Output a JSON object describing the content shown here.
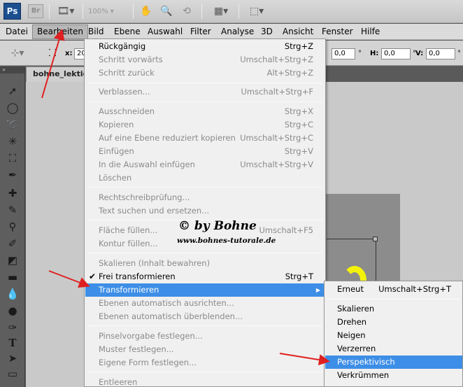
{
  "appbar": {
    "logo": "Ps",
    "bridge": "Br",
    "zoom": "100%"
  },
  "menubar": {
    "items": [
      "Datei",
      "Bearbeiten",
      "Bild",
      "Ebene",
      "Auswahl",
      "Filter",
      "Analyse",
      "3D",
      "Ansicht",
      "Fenster",
      "Hilfe"
    ],
    "active_index": 1
  },
  "options": {
    "x_label": "x:",
    "x_value": "20",
    "angle_value": "0,0",
    "degree": "°",
    "h_label": "H:",
    "h_value": "0,0",
    "v_label": "V:",
    "v_value": "0,0"
  },
  "document": {
    "tab": "bohne_lektion"
  },
  "tools_grip": "»",
  "menu": {
    "items": [
      {
        "label": "Rückgängig",
        "shortcut": "Strg+Z",
        "enabled": true
      },
      {
        "label": "Schritt vorwärts",
        "shortcut": "Umschalt+Strg+Z",
        "enabled": false
      },
      {
        "label": "Schritt zurück",
        "shortcut": "Alt+Strg+Z",
        "enabled": false
      },
      {
        "label": "Verblassen...",
        "shortcut": "Umschalt+Strg+F",
        "enabled": false
      },
      {
        "label": "Ausschneiden",
        "shortcut": "Strg+X",
        "enabled": false
      },
      {
        "label": "Kopieren",
        "shortcut": "Strg+C",
        "enabled": false
      },
      {
        "label": "Auf eine Ebene reduziert kopieren",
        "shortcut": "Umschalt+Strg+C",
        "enabled": false
      },
      {
        "label": "Einfügen",
        "shortcut": "Strg+V",
        "enabled": false
      },
      {
        "label": "In die Auswahl einfügen",
        "shortcut": "Umschalt+Strg+V",
        "enabled": false
      },
      {
        "label": "Löschen",
        "shortcut": "",
        "enabled": false
      },
      {
        "label": "Rechtschreibprüfung...",
        "shortcut": "",
        "enabled": false
      },
      {
        "label": "Text suchen und ersetzen...",
        "shortcut": "",
        "enabled": false
      },
      {
        "label": "Fläche füllen...",
        "shortcut": "Umschalt+F5",
        "enabled": false
      },
      {
        "label": "Kontur füllen...",
        "shortcut": "",
        "enabled": false
      },
      {
        "label": "Skalieren (Inhalt bewahren)",
        "shortcut": "",
        "enabled": false
      },
      {
        "label": "Frei transformieren",
        "shortcut": "Strg+T",
        "enabled": true,
        "checked": true
      },
      {
        "label": "Transformieren",
        "shortcut": "",
        "enabled": true,
        "highlight": true,
        "submenu": true
      },
      {
        "label": "Ebenen automatisch ausrichten...",
        "shortcut": "",
        "enabled": false
      },
      {
        "label": "Ebenen automatisch überblenden...",
        "shortcut": "",
        "enabled": false
      },
      {
        "label": "Pinselvorgabe festlegen...",
        "shortcut": "",
        "enabled": false
      },
      {
        "label": "Muster festlegen...",
        "shortcut": "",
        "enabled": false
      },
      {
        "label": "Eigene Form festlegen...",
        "shortcut": "",
        "enabled": false
      },
      {
        "label": "Entleeren",
        "shortcut": "",
        "enabled": false
      }
    ]
  },
  "submenu": {
    "items": [
      {
        "label": "Erneut",
        "shortcut": "Umschalt+Strg+T"
      },
      {
        "label": "Skalieren",
        "shortcut": ""
      },
      {
        "label": "Drehen",
        "shortcut": ""
      },
      {
        "label": "Neigen",
        "shortcut": ""
      },
      {
        "label": "Verzerren",
        "shortcut": ""
      },
      {
        "label": "Perspektivisch",
        "shortcut": "",
        "highlight": true
      },
      {
        "label": "Verkrümmen",
        "shortcut": ""
      }
    ]
  },
  "watermark": {
    "line1": "© by Bohne",
    "line2": "www.bohnes-tutorale.de"
  },
  "colors": {
    "highlight": "#3d8ee6",
    "arrow": "#e02020",
    "blob": "#f4f20b"
  }
}
